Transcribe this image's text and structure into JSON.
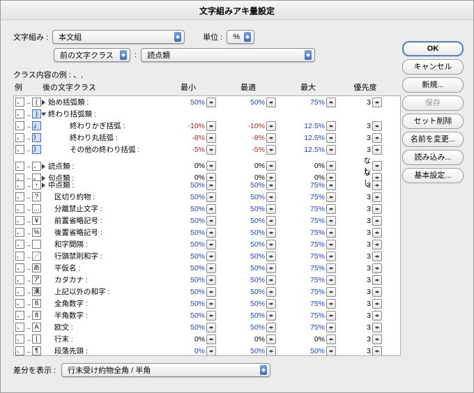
{
  "title": "文字組みアキ量設定",
  "top": {
    "set_label": "文字組み :",
    "set_value": "本文組",
    "unit_label": "単位 :",
    "unit_value": "%",
    "prev_class_value": "前の文字クラス",
    "sep": ":",
    "char_class_value": "読点類"
  },
  "class_example_label": "クラス内容の例 :  、,",
  "columns": {
    "example": "例",
    "after_class": "後の文字クラス",
    "min": "最小",
    "opt": "最適",
    "max": "最大",
    "priority": "優先度"
  },
  "rows": [
    {
      "g": "(",
      "label": "始め括弧類 :",
      "disc": "closed",
      "min": "50%",
      "opt": "50%",
      "max": "75%",
      "pri": "3",
      "mod": true
    },
    {
      "g": ")",
      "label": "終わり括弧類 :",
      "disc": "open",
      "header": true,
      "sel": true
    },
    {
      "g": "」",
      "label": "終わりかぎ括弧 :",
      "indent": 2,
      "min": "-10%",
      "opt": "-10%",
      "max": "12.5%",
      "pri": "3",
      "neg": true,
      "mod": true,
      "sel": true
    },
    {
      "g": "）",
      "label": "終わり丸括弧 :",
      "indent": 2,
      "min": "-8%",
      "opt": "-8%",
      "max": "12.5%",
      "pri": "3",
      "neg": true,
      "mod": true,
      "sel": true
    },
    {
      "g": "〕",
      "label": "その他の終わり括弧 :",
      "indent": 2,
      "min": "-5%",
      "opt": "-5%",
      "max": "12.5%",
      "pri": "3",
      "neg": true,
      "mod": true,
      "sel": true
    },
    {
      "g": "、",
      "label": "読点類 :",
      "disc": "closed",
      "min": "0%",
      "opt": "0%",
      "max": "0%",
      "pri": "なし"
    },
    {
      "g": "。",
      "label": "句点類 :",
      "disc": "closed",
      "min": "0%",
      "opt": "0%",
      "max": "0%",
      "pri": "なし"
    },
    {
      "g": "・",
      "label": "中点類 :",
      "disc": "closed",
      "min": "50%",
      "opt": "50%",
      "max": "75%",
      "pri": "3",
      "mod": true
    },
    {
      "g": "?",
      "label": "区切り約物 :",
      "min": "50%",
      "opt": "50%",
      "max": "75%",
      "pri": "3",
      "mod": true
    },
    {
      "g": "…",
      "label": "分離禁止文字 :",
      "min": "50%",
      "opt": "50%",
      "max": "75%",
      "pri": "3",
      "mod": true
    },
    {
      "g": "￥",
      "label": "前置省略記号 :",
      "min": "50%",
      "opt": "50%",
      "max": "75%",
      "pri": "3",
      "mod": true
    },
    {
      "g": "%",
      "label": "後置省略記号 :",
      "min": "50%",
      "opt": "50%",
      "max": "75%",
      "pri": "3",
      "mod": true
    },
    {
      "g": " ",
      "label": "和字間隔 :",
      "min": "50%",
      "opt": "50%",
      "max": "75%",
      "pri": "3",
      "mod": true
    },
    {
      "g": "／",
      "label": "行頭禁則和字 :",
      "min": "50%",
      "opt": "50%",
      "max": "75%",
      "pri": "3",
      "mod": true
    },
    {
      "g": "あ",
      "label": "平仮名 :",
      "min": "50%",
      "opt": "50%",
      "max": "75%",
      "pri": "3",
      "mod": true
    },
    {
      "g": "ア",
      "label": "カタカナ :",
      "min": "50%",
      "opt": "50%",
      "max": "75%",
      "pri": "3",
      "mod": true
    },
    {
      "g": "漢",
      "label": "上記以外の和字 :",
      "min": "50%",
      "opt": "50%",
      "max": "75%",
      "pri": "3",
      "mod": true
    },
    {
      "g": "８",
      "label": "全角数字 :",
      "min": "50%",
      "opt": "50%",
      "max": "75%",
      "pri": "3",
      "mod": true
    },
    {
      "g": "8",
      "label": "半角数字 :",
      "min": "50%",
      "opt": "50%",
      "max": "75%",
      "pri": "3",
      "mod": true
    },
    {
      "g": "A",
      "label": "欧文 :",
      "min": "50%",
      "opt": "50%",
      "max": "75%",
      "pri": "3",
      "mod": true
    },
    {
      "g": "|",
      "label": "行末 :",
      "min": "0%",
      "opt": "0%",
      "max": "0%",
      "pri": "3"
    },
    {
      "g": "¶",
      "label": "段落先頭 :",
      "min": "0%",
      "opt": "50%",
      "max": "50%",
      "pri": "3",
      "mod": true
    }
  ],
  "footer": {
    "diff_label": "差分を表示 :",
    "diff_value": "行末受け約物全角 / 半角"
  },
  "buttons": {
    "ok": "OK",
    "cancel": "キャンセル",
    "new": "新規...",
    "save": "保存",
    "delete_set": "セット削除",
    "rename": "名前を変更...",
    "import": "読み込み...",
    "basic": "基本設定..."
  }
}
